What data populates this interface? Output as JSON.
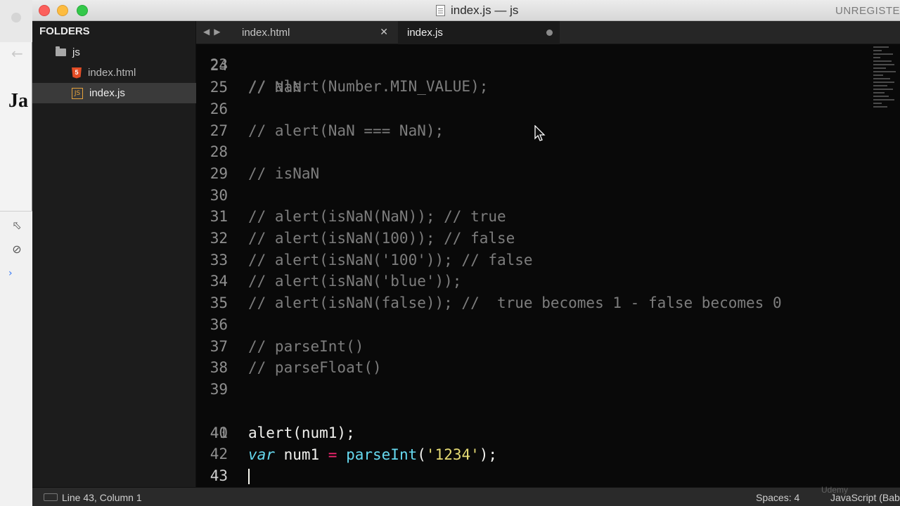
{
  "background_window": {
    "partial_heading": "Ja"
  },
  "window": {
    "title": "index.js — js",
    "unregistered": "UNREGISTE"
  },
  "sidebar": {
    "header": "FOLDERS",
    "folder": "js",
    "files": [
      {
        "name": "index.html",
        "icon": "html5-file-icon"
      },
      {
        "name": "index.js",
        "icon": "js-file-icon",
        "selected": true
      }
    ]
  },
  "tabs": [
    {
      "label": "index.html",
      "active": false
    },
    {
      "label": "index.js",
      "active": true,
      "unsaved": true
    }
  ],
  "code": {
    "cutoff_line": "// alert(Number.MIN_VALUE);",
    "lines": [
      {
        "n": "24",
        "text": ""
      },
      {
        "n": "25",
        "text": "// NaN"
      },
      {
        "n": "26",
        "text": ""
      },
      {
        "n": "27",
        "text": "// alert(NaN === NaN);"
      },
      {
        "n": "28",
        "text": ""
      },
      {
        "n": "29",
        "text": "// isNaN"
      },
      {
        "n": "30",
        "text": ""
      },
      {
        "n": "31",
        "text": "// alert(isNaN(NaN)); // true"
      },
      {
        "n": "32",
        "text": "// alert(isNaN(100)); // false"
      },
      {
        "n": "33",
        "text": "// alert(isNaN('100')); // false"
      },
      {
        "n": "34",
        "text": "// alert(isNaN('blue'));"
      },
      {
        "n": "35",
        "text": "// alert(isNaN(false)); //  true becomes 1 - false becomes 0"
      },
      {
        "n": "36",
        "text": ""
      },
      {
        "n": "37",
        "text": "// parseInt()"
      },
      {
        "n": "38",
        "text": "// parseFloat()"
      },
      {
        "n": "39",
        "text": ""
      },
      {
        "n": "40",
        "tokens": {
          "kw": "var",
          "name": " num1 ",
          "op": "=",
          "fn": " parseInt",
          "open": "(",
          "str": "'1234'",
          "close": ");"
        }
      },
      {
        "n": "41",
        "text": "alert(num1);"
      },
      {
        "n": "42",
        "text": ""
      },
      {
        "n": "43",
        "text": "",
        "current": true
      }
    ]
  },
  "status": {
    "position": "Line 43, Column 1",
    "spaces": "Spaces: 4",
    "syntax": "JavaScript (Babel)"
  },
  "watermark": "Udemy"
}
